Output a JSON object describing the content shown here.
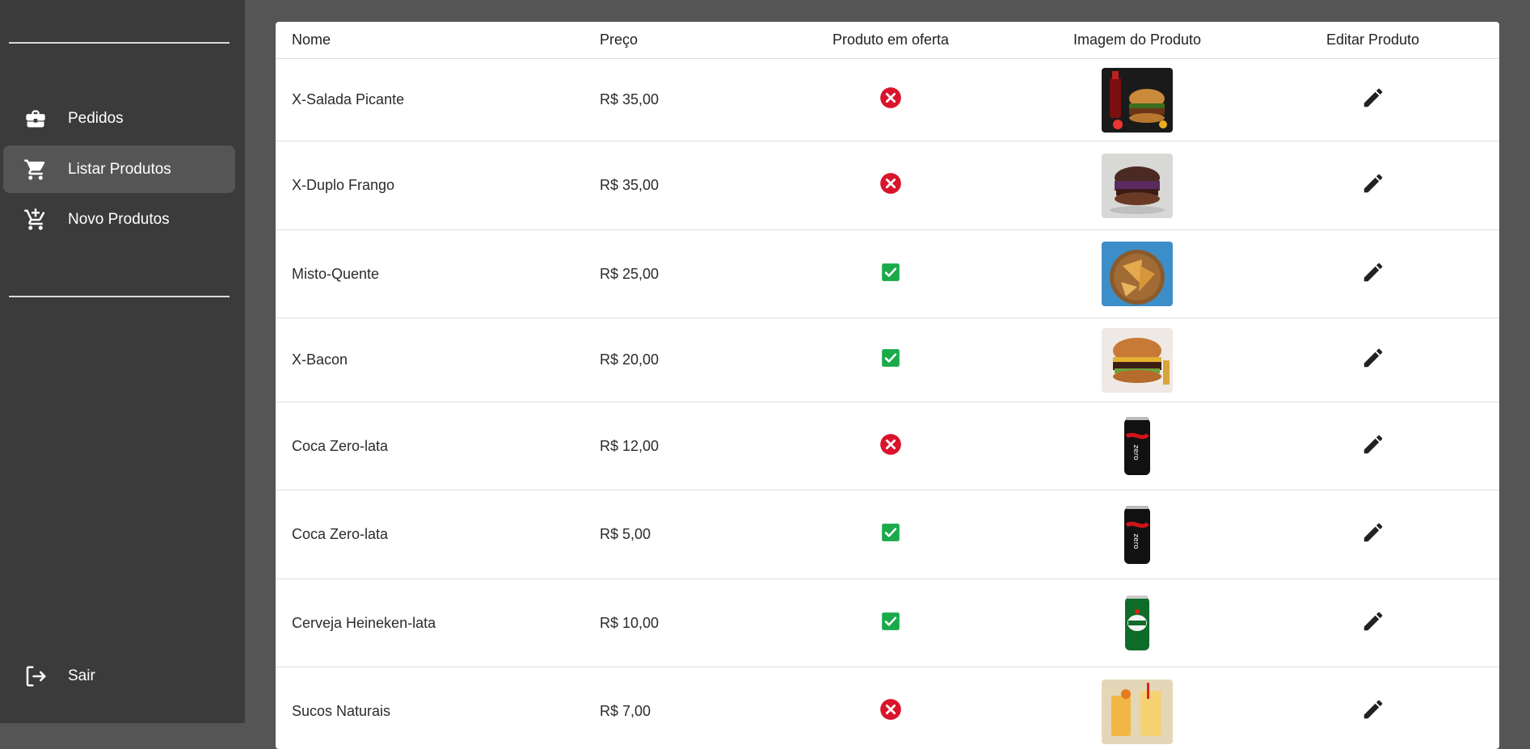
{
  "sidebar": {
    "items": [
      {
        "label": "Pedidos",
        "icon": "briefcase-icon"
      },
      {
        "label": "Listar Produtos",
        "icon": "cart-icon",
        "active": true
      },
      {
        "label": "Novo Produtos",
        "icon": "add-cart-icon"
      }
    ],
    "logout": {
      "label": "Sair",
      "icon": "logout-icon"
    }
  },
  "table": {
    "headers": {
      "name": "Nome",
      "price": "Preço",
      "offer": "Produto em oferta",
      "image": "Imagem do Produto",
      "edit": "Editar Produto"
    },
    "rows": [
      {
        "name": "X-Salada Picante",
        "price": "R$ 35,00",
        "offer": false,
        "image": "burger-with-soda"
      },
      {
        "name": "X-Duplo Frango",
        "price": "R$ 35,00",
        "offer": false,
        "image": "purple-cabbage-burger"
      },
      {
        "name": "Misto-Quente",
        "price": "R$ 25,00",
        "offer": true,
        "image": "grilled-sandwich"
      },
      {
        "name": "X-Bacon",
        "price": "R$ 20,00",
        "offer": true,
        "image": "bacon-burger"
      },
      {
        "name": "Coca Zero-lata",
        "price": "R$ 12,00",
        "offer": false,
        "image": "coca-zero-can"
      },
      {
        "name": "Coca Zero-lata",
        "price": "R$ 5,00",
        "offer": true,
        "image": "coca-zero-can"
      },
      {
        "name": "Cerveja Heineken-lata",
        "price": "R$ 10,00",
        "offer": true,
        "image": "heineken-can"
      },
      {
        "name": "Sucos Naturais",
        "price": "R$ 7,00",
        "offer": false,
        "image": "natural-juices"
      }
    ]
  },
  "colors": {
    "sidebar_bg": "#3b3b3b",
    "content_bg": "#555555",
    "active_item_bg": "#555555",
    "offer_yes": "#1aaa4a",
    "offer_no": "#d9142b"
  }
}
